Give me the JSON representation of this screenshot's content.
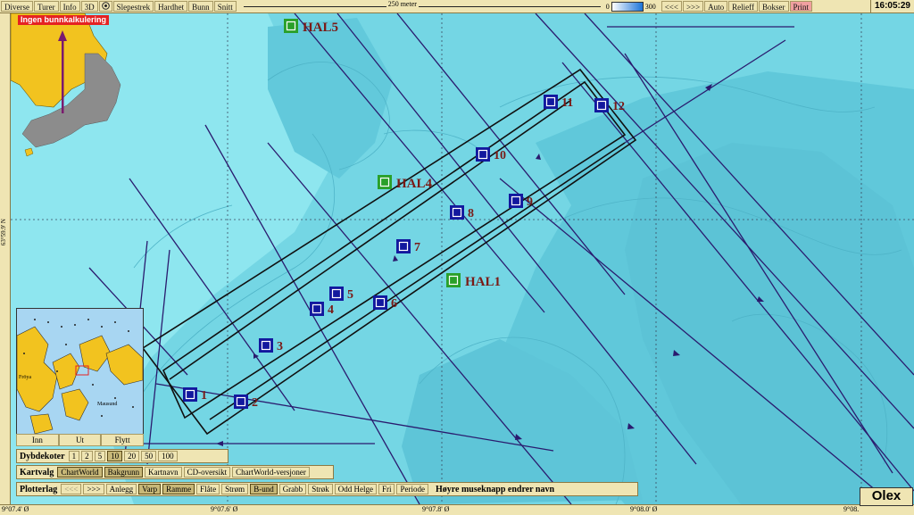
{
  "topbar": {
    "menu": [
      "Diverse",
      "Turer",
      "Info",
      "3D",
      "Slepestrek",
      "Hardhet",
      "Bunn",
      "Snitt"
    ],
    "scale_label": "250 meter",
    "depth_min": "0",
    "depth_max": "300",
    "right_buttons": [
      "<<<",
      ">>>",
      "Auto",
      "Relieff",
      "Bokser",
      "Print"
    ],
    "clock": "16:05:29"
  },
  "warning": "Ingen bunnkalkulering",
  "rulers": {
    "lat": "63°59.9' N",
    "lon": [
      "9°07.4' Ø",
      "9°07.6' Ø",
      "9°07.8' Ø",
      "9°08.0' Ø",
      "9°08."
    ]
  },
  "overview": {
    "buttons": [
      "Inn",
      "Ut",
      "Flytt"
    ],
    "place_labels": [
      "Fröya",
      "Mausund"
    ]
  },
  "dybdekoter": {
    "label": "Dybdekoter",
    "values": [
      "1",
      "2",
      "5",
      "10",
      "20",
      "50",
      "100"
    ],
    "selected": "10"
  },
  "kartvalg": {
    "label": "Kartvalg",
    "options": [
      "ChartWorld",
      "Bakgrunn",
      "Kartnavn",
      "CD-oversikt",
      "ChartWorld-versjoner"
    ],
    "selected": [
      "ChartWorld",
      "Bakgrunn"
    ]
  },
  "plotterlag": {
    "label": "Plotterlag",
    "options": [
      "<<<",
      ">>>",
      "Anlegg",
      "Varp",
      "Ramme",
      "Flåte",
      "Strøm",
      "B-und",
      "Grabb",
      "Strøk",
      "Odd Helge",
      "Fri",
      "Periode"
    ],
    "selected": [
      "Varp",
      "Ramme",
      "B-und"
    ],
    "hint": "Høyre museknapp endrer navn"
  },
  "logo": "Olex",
  "markers": [
    "1",
    "2",
    "3",
    "4",
    "5",
    "6",
    "7",
    "8",
    "9",
    "10",
    "11",
    "12"
  ],
  "hal": [
    "HAL5",
    "HAL4",
    "HAL1"
  ],
  "colors": {
    "ui_bg": "#efe5b3",
    "water_light": "#8ee6ef",
    "water_mid": "#6fd1e0",
    "water_deep": "#55c0d4",
    "land": "#f2c31f",
    "marker": "#12189e",
    "hal": "#2aa02a",
    "label": "#7a1a16",
    "line": "#2a1b6e",
    "warning": "#e52222"
  }
}
